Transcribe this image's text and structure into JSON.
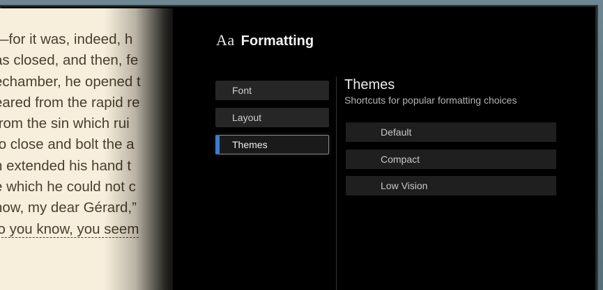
{
  "book": {
    "lines": [
      "—for it was, indeed, h",
      "as closed, and then, fe",
      "echamber, he opened t",
      "eared from the rapid re",
      " from the sin which rui",
      "to close and bolt the a",
      "n extended his hand t",
      "e which he could not c",
      "now, my dear Gérard,”",
      "lo you know, you seem"
    ]
  },
  "panel": {
    "icon": "Aa",
    "title": "Formatting"
  },
  "nav": {
    "items": [
      {
        "label": "Font"
      },
      {
        "label": "Layout"
      },
      {
        "label": "Themes"
      }
    ],
    "selected": "Themes"
  },
  "themes": {
    "title": "Themes",
    "subtitle": "Shortcuts for popular formatting choices",
    "options": [
      {
        "label": "Default"
      },
      {
        "label": "Compact"
      },
      {
        "label": "Low Vision"
      }
    ]
  },
  "colors": {
    "accent": "#3a7bd5",
    "page_background": "#f7efdc",
    "panel_background": "#000000"
  }
}
